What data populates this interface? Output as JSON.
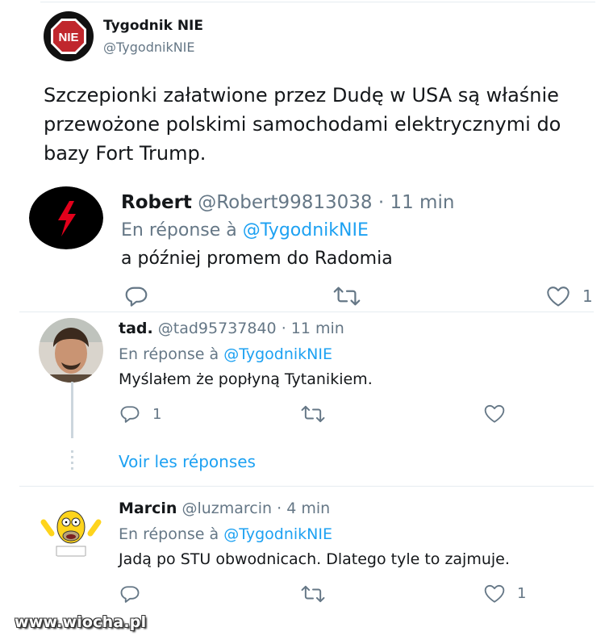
{
  "main_tweet": {
    "name": "Tygodnik NIE",
    "handle": "@TygodnikNIE",
    "logo_text": "NIE",
    "text": "Szczepionki załatwione przez Dudę w USA są właśnie przewożone polskimi samochodami elektrycznymi do bazy Fort Trump."
  },
  "replies": [
    {
      "name": "Robert",
      "handle": "@Robert99813038",
      "sep": "·",
      "time": "11 min",
      "in_reply_prefix": "En réponse à",
      "in_reply_to": "@TygodnikNIE",
      "text": "a później promem do Radomia",
      "reply_count": "",
      "retweet_count": "",
      "like_count": "1"
    },
    {
      "name": "tad.",
      "handle": "@tad95737840",
      "sep": "·",
      "time": "11 min",
      "in_reply_prefix": "En réponse à",
      "in_reply_to": "@TygodnikNIE",
      "text": "Myślałem że popłyną Tytanikiem.",
      "reply_count": "1",
      "retweet_count": "",
      "like_count": ""
    },
    {
      "name": "Marcin",
      "handle": "@luzmarcin",
      "sep": "·",
      "time": "4 min",
      "in_reply_prefix": "En réponse à",
      "in_reply_to": "@TygodnikNIE",
      "text": "Jadą po STU obwodnicach. Dlatego tyle to zajmuje.",
      "reply_count": "",
      "retweet_count": "",
      "like_count": "1"
    }
  ],
  "show_replies_label": "Voir les réponses",
  "watermark": "www.wiocha.pl",
  "colors": {
    "link": "#1da1f2",
    "secondary_text": "#657786",
    "divider": "#e6ecf0",
    "stop_red": "#c0272d"
  },
  "icons": [
    "reply-icon",
    "retweet-icon",
    "like-icon",
    "lightning-bolt-icon",
    "stop-sign-icon"
  ]
}
